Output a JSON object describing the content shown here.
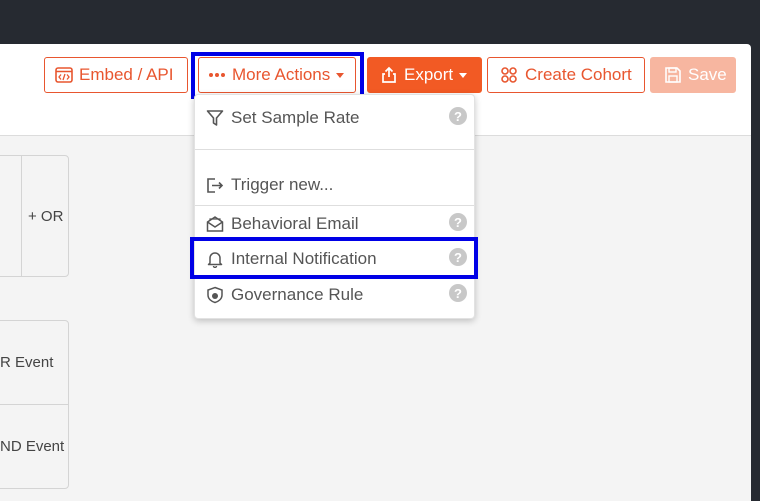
{
  "toolbar": {
    "embed_label": "Embed / API",
    "more_actions_label": "More Actions",
    "export_label": "Export",
    "create_cohort_label": "Create Cohort",
    "save_label": "Save"
  },
  "query": {
    "or_label": "+ OR",
    "or_event_label": "R Event",
    "and_event_label": "ND Event"
  },
  "menu": {
    "set_sample_rate": "Set Sample Rate",
    "trigger_new": "Trigger new...",
    "behavioral_email": "Behavioral Email",
    "internal_notification": "Internal Notification",
    "governance_rule": "Governance Rule",
    "help_glyph": "?"
  },
  "colors": {
    "accent": "#f25a24",
    "highlight": "#0000e6",
    "background": "#262a31"
  }
}
